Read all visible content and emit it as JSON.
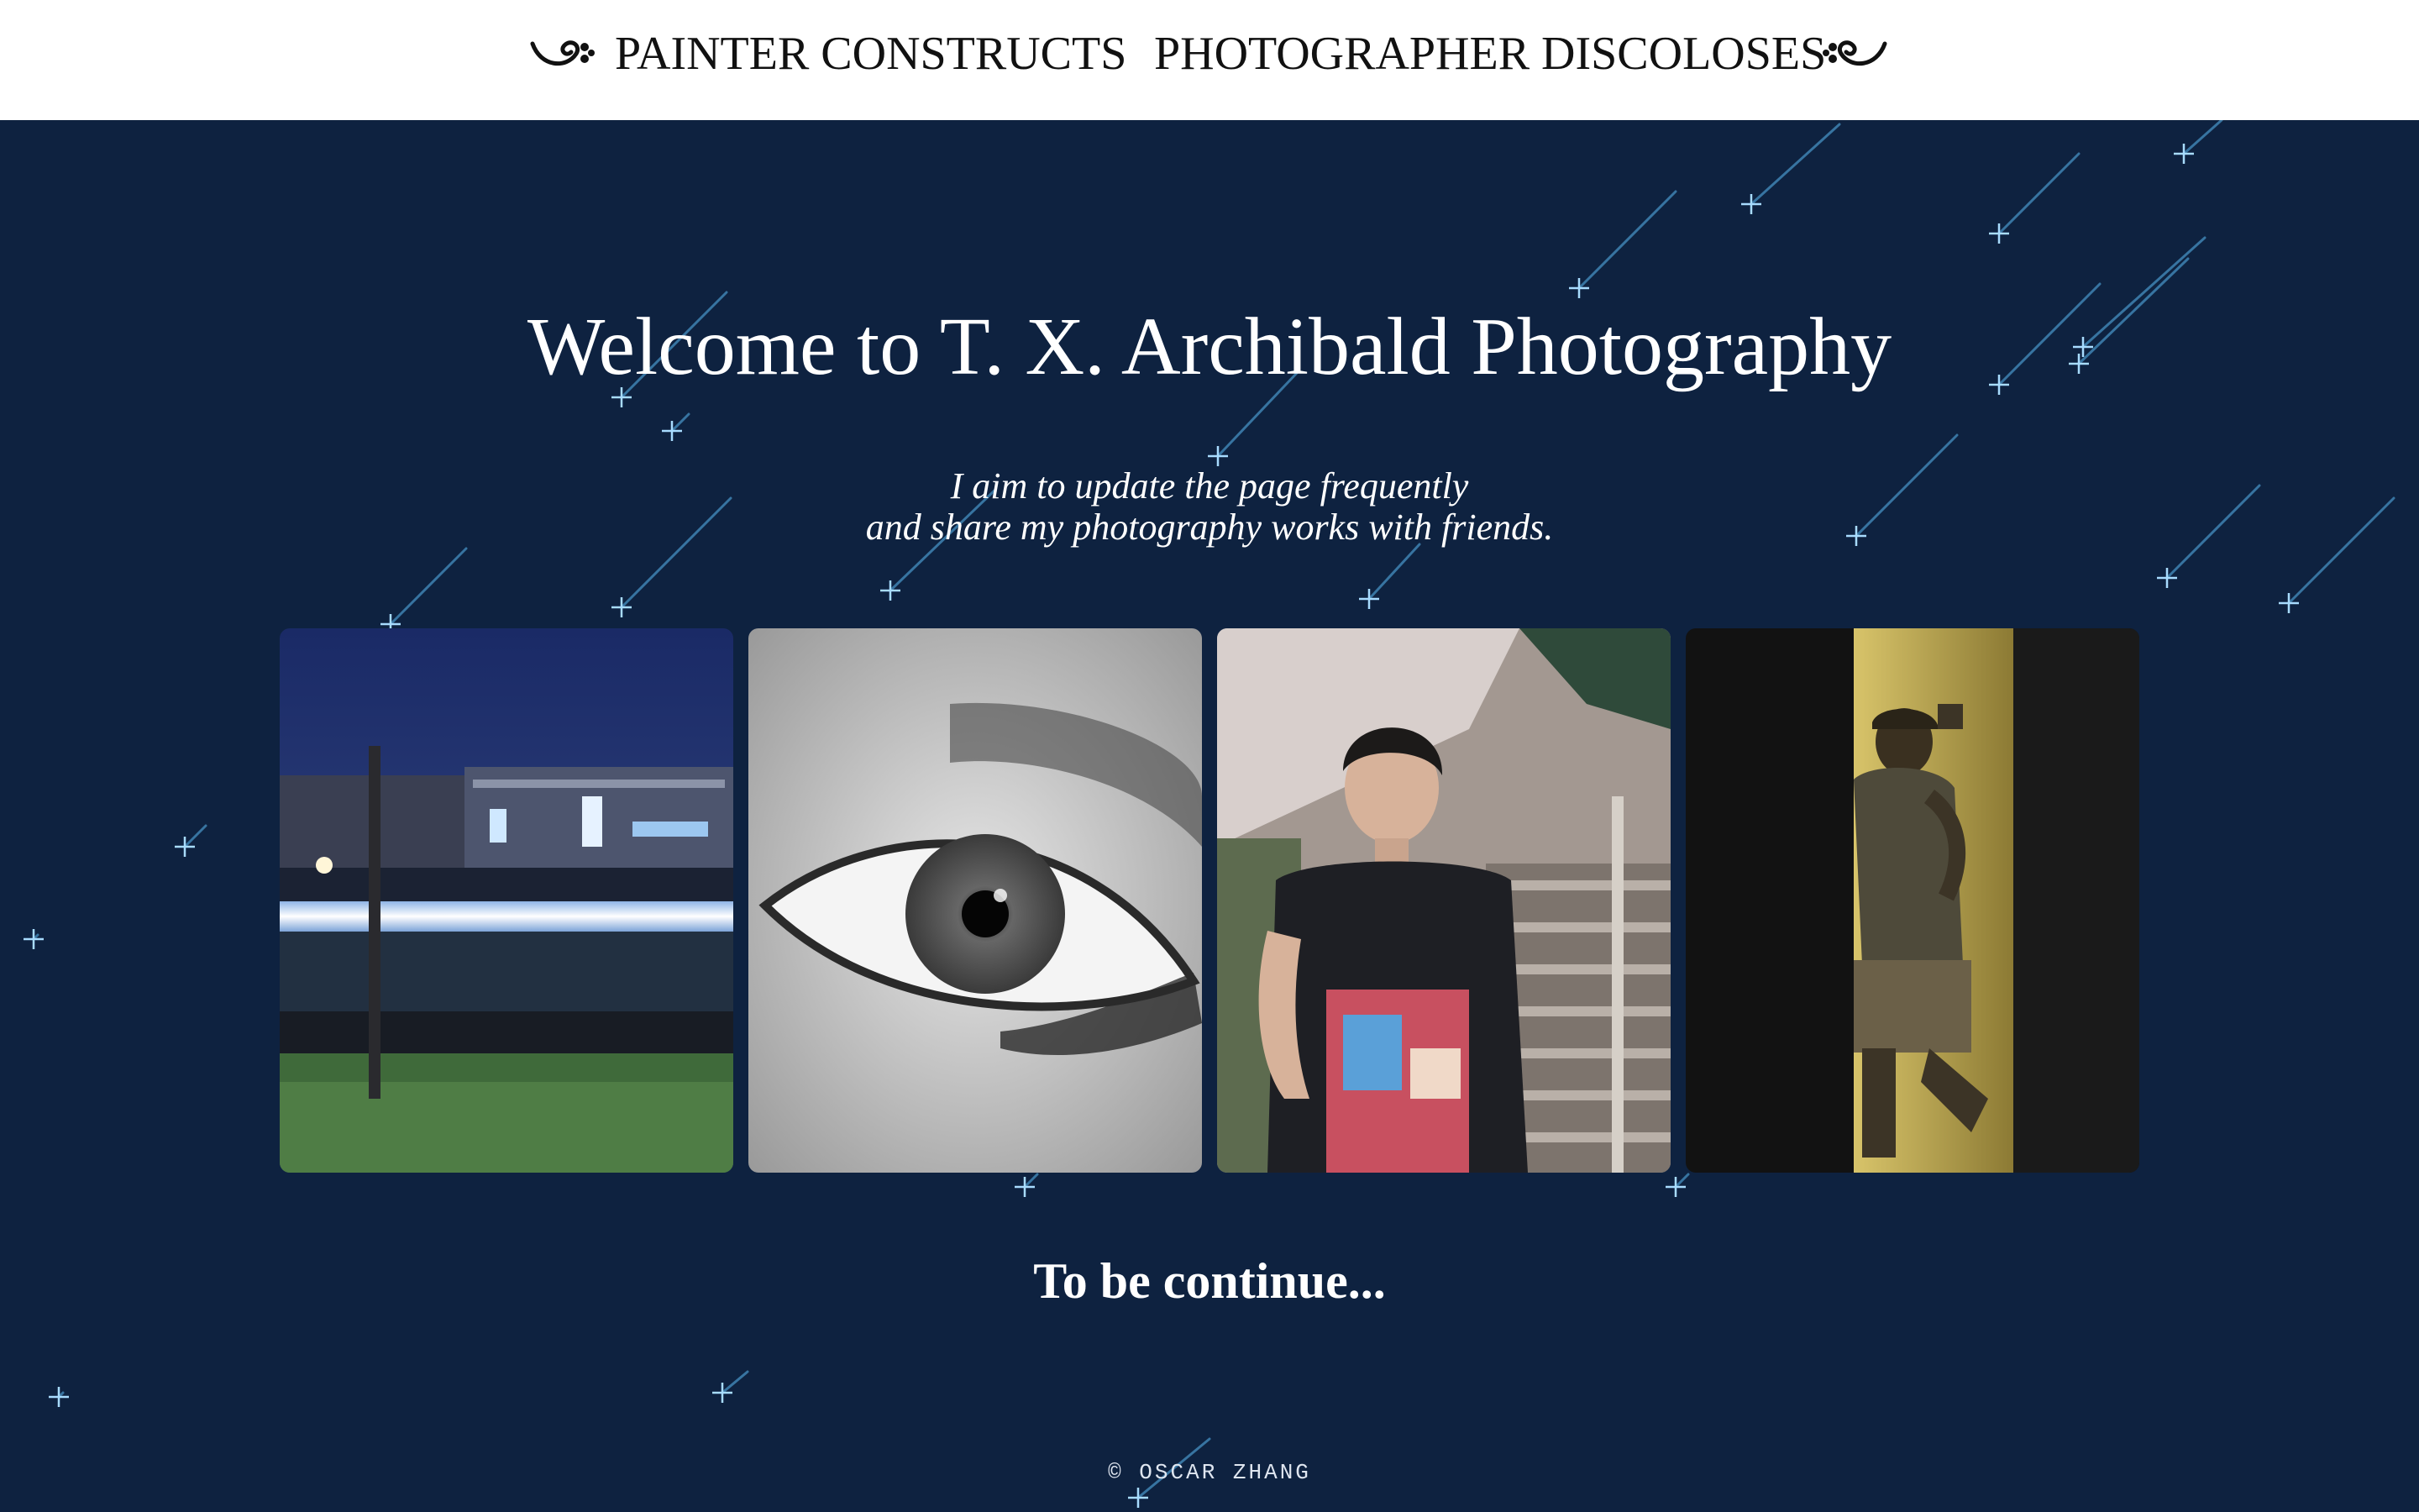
{
  "nav": {
    "items": [
      {
        "label": "PAINTER CONSTRUCTS"
      },
      {
        "label": "PHOTOGRAPHER DISCOLOSES"
      }
    ],
    "ornament_icon": "swirl-ornament-icon"
  },
  "hero": {
    "title": "Welcome to T. X. Archibald Photography",
    "subtitle_line1": "I aim to update the page frequently",
    "subtitle_line2": "and share my photography works with friends."
  },
  "gallery": {
    "photos": [
      {
        "subject": "night train light trails"
      },
      {
        "subject": "black and white eye close-up"
      },
      {
        "subject": "young man on stairs portrait"
      },
      {
        "subject": "man in yellow-lit doorway"
      }
    ]
  },
  "closing": "To be continue...",
  "footer": "© OSCAR ZHANG",
  "colors": {
    "background": "#0e2240",
    "header": "#ffffff",
    "meteor": "#5ab8f0",
    "text": "#ffffff"
  }
}
